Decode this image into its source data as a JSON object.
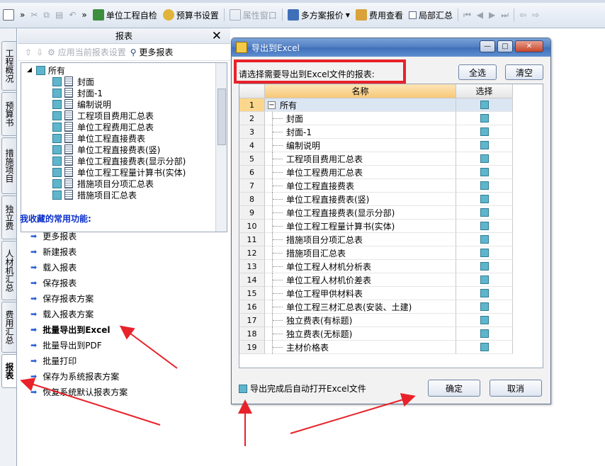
{
  "toolbar": {
    "items": [
      {
        "label": "单位工程自检",
        "icon": "check-table-icon"
      },
      {
        "label": "预算书设置",
        "icon": "settings-icon"
      },
      {
        "label": "属性窗口",
        "icon": "window-icon",
        "disabled": true
      },
      {
        "label": "多方案报价",
        "icon": "scheme-icon"
      },
      {
        "label": "费用查看",
        "icon": "fee-view-icon"
      },
      {
        "label": "局部汇总",
        "icon": "checkbox-icon"
      }
    ]
  },
  "vtabs": [
    "工程概况",
    "预算书",
    "措施项目",
    "独立费",
    "人材机汇总",
    "费用汇总",
    "报表"
  ],
  "panel": {
    "title": "报表",
    "apply_settings": "应用当前报表设置",
    "more_reports": "更多报表",
    "tree": [
      "所有",
      "封面",
      "封面-1",
      "编制说明",
      "工程项目费用汇总表",
      "单位工程费用汇总表",
      "单位工程直接费表",
      "单位工程直接费表(竖)",
      "单位工程直接费表(显示分部)",
      "单位工程工程量计算书(实体)",
      "措施项目分项汇总表",
      "措施项目汇总表"
    ],
    "favorites_title": "我收藏的常用功能:",
    "favorites": [
      "更多报表",
      "新建报表",
      "载入报表",
      "保存报表",
      "保存报表方案",
      "载入报表方案",
      "批量导出到Excel",
      "批量导出到PDF",
      "批量打印",
      "保存为系统报表方案",
      "恢复系统默认报表方案"
    ]
  },
  "dialog": {
    "title": "导出到Excel",
    "prompt": "请选择需要导出到Excel文件的报表:",
    "select_all": "全选",
    "clear": "清空",
    "col_name": "名称",
    "col_select": "选择",
    "rows": [
      {
        "num": "1",
        "name": "所有"
      },
      {
        "num": "2",
        "name": "封面"
      },
      {
        "num": "3",
        "name": "封面-1"
      },
      {
        "num": "4",
        "name": "编制说明"
      },
      {
        "num": "5",
        "name": "工程项目费用汇总表"
      },
      {
        "num": "6",
        "name": "单位工程费用汇总表"
      },
      {
        "num": "7",
        "name": "单位工程直接费表"
      },
      {
        "num": "8",
        "name": "单位工程直接费表(竖)"
      },
      {
        "num": "9",
        "name": "单位工程直接费表(显示分部)"
      },
      {
        "num": "10",
        "name": "单位工程工程量计算书(实体)"
      },
      {
        "num": "11",
        "name": "措施项目分项汇总表"
      },
      {
        "num": "12",
        "name": "措施项目汇总表"
      },
      {
        "num": "13",
        "name": "单位工程人材机分析表"
      },
      {
        "num": "14",
        "name": "单位工程人材机价差表"
      },
      {
        "num": "15",
        "name": "单位工程甲供材料表"
      },
      {
        "num": "16",
        "name": "单位工程三材汇总表(安装、土建)"
      },
      {
        "num": "17",
        "name": "独立费表(有标题)"
      },
      {
        "num": "18",
        "name": "独立费表(无标题)"
      },
      {
        "num": "19",
        "name": "主材价格表"
      }
    ],
    "auto_open": "导出完成后自动打开Excel文件",
    "ok": "确定",
    "cancel": "取消"
  },
  "colors": {
    "accent_red": "#e8222a",
    "checkbox": "#5fb6cc",
    "title_blue": "#4f7dc2",
    "favorites_blue": "#0b2fc9"
  }
}
